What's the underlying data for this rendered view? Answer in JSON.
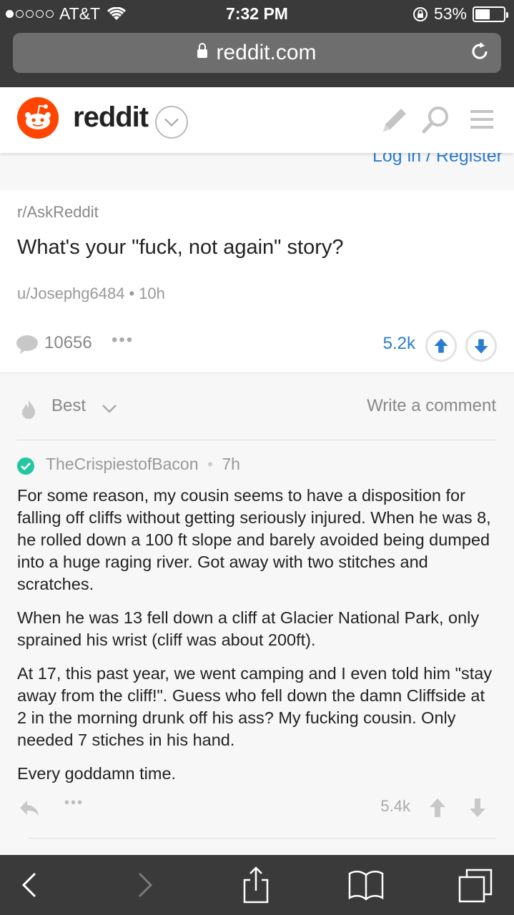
{
  "status_bar": {
    "carrier": "AT&T",
    "time": "7:32 PM",
    "battery": "53%",
    "battery_level": 0.53
  },
  "browser": {
    "url": "reddit.com"
  },
  "header": {
    "brand": "reddit",
    "login_link": "Log in / Register"
  },
  "post": {
    "subreddit": "r/AskReddit",
    "title": "What's your \"fuck, not again\" story?",
    "author": "u/Josephg6484",
    "age": "10h",
    "separator": "•",
    "comment_count": "10656",
    "more": "•••",
    "score": "5.2k"
  },
  "comments": {
    "sort_label": "Best",
    "write_comment": "Write a comment",
    "items": [
      {
        "author": "TheCrispiestofBacon",
        "separator": "•",
        "age": "7h",
        "paragraphs": [
          "For some reason, my cousin seems to have a disposition for falling off cliffs without getting seriously injured. When he was 8, he rolled down a 100 ft slope and barely avoided being dumped into a huge raging river. Got away with two stitches and scratches.",
          "When he was 13 fell down a cliff at Glacier National Park, only sprained his wrist (cliff was about 200ft).",
          "At 17, this past year, we went camping and I even told him \"stay away from the cliff!\". Guess who fell down the damn Cliffside at 2 in the morning drunk off his ass? My fucking cousin. Only needed 7 stiches in his hand.",
          "Every goddamn time."
        ],
        "more": "•••",
        "score": "5.4k"
      }
    ]
  },
  "colors": {
    "brand": "#ff4500",
    "link": "#2a7dcf",
    "verified": "#24c7a1",
    "chrome": "#3a3a3a"
  },
  "icons": [
    "signal-dots",
    "wifi-icon",
    "rotation-lock-icon",
    "battery-icon",
    "lock-icon",
    "reload-icon",
    "snoo-logo-icon",
    "chevron-down-icon",
    "pencil-icon",
    "search-icon",
    "menu-icon",
    "comment-icon",
    "upvote-icon",
    "downvote-icon",
    "flame-icon",
    "check-icon",
    "reply-icon",
    "back-icon",
    "forward-icon",
    "share-icon",
    "bookmarks-icon",
    "tabs-icon"
  ]
}
